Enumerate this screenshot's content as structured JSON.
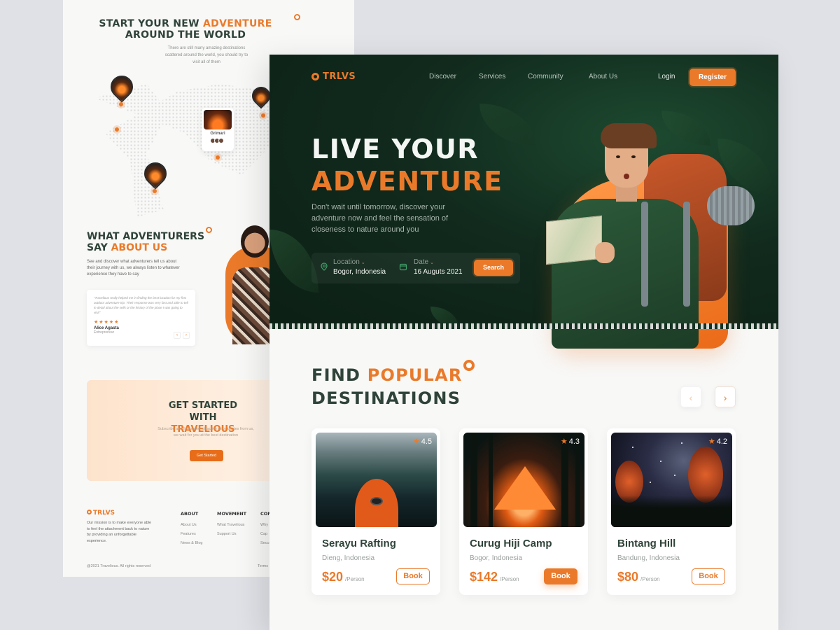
{
  "back": {
    "hero_title_1": "START YOUR NEW ",
    "hero_title_accent": "ADVENTURE",
    "hero_title_2": "AROUND THE WORLD",
    "hero_sub": "There are still many amazing destinations scattered around the world, you should try to visit all of them",
    "map_card_label": "Grimari",
    "say_title_1": "WHAT ADVENTURERS",
    "say_title_2": "SAY ",
    "say_title_accent": "ABOUT US",
    "say_sub": "See and discover what adventurers tell us about their journey with us, we always listen to whatever experience they have to say",
    "review_quote": "\"Travelious really helped me in finding the best location for my first outdoor adventure trip. Their response was very fast and able to tell in detail about the sells or the history of the place I was going to visit\"",
    "review_stars": "★★★★★",
    "review_name": "Alice Agasta",
    "review_role": "Entrepreneur",
    "review_prev": "‹",
    "review_next": "›",
    "started_title_1": "GET STARTED WITH",
    "started_title_accent": "TRAVELIOUS",
    "started_sub": "Subscribe and find super attractive price quotes from us, we wait for you at the best destination",
    "started_button": "Get Started",
    "footer_logo": "TRLVS",
    "footer_desc": "Our mission is to make everyone able to feel the attachment back to nature by providing an unforgettable experience.",
    "footer_about_heading": "ABOUT",
    "footer_about_items": [
      "About Us",
      "Features",
      "News & Blog"
    ],
    "footer_movement_heading": "MOVEMENT",
    "footer_movement_items": [
      "What Travelious",
      "Support Us"
    ],
    "footer_col3_heading": "CON",
    "footer_col3_items": [
      "Why",
      "Cap",
      "Secu"
    ],
    "footer_copy": "@2021 Travelious. All rights reserved",
    "footer_terms": "Terms"
  },
  "nav": {
    "logo": "TRLVS",
    "items": [
      "Discover",
      "Services",
      "Community",
      "About Us"
    ],
    "login": "Login",
    "register": "Register"
  },
  "hero": {
    "title_line1": "LIVE YOUR",
    "title_line2": "ADVENTURE",
    "description": "Don't wait until tomorrow, discover your adventure now and feel the sensation of closeness to nature around you",
    "location_label": "Location",
    "location_value": "Bogor, Indonesia",
    "date_label": "Date",
    "date_value": "16 Auguts 2021",
    "search_button": "Search",
    "chevron": "⌄"
  },
  "popular": {
    "title_1": "FIND ",
    "title_accent": "POPULAR",
    "title_2": "DESTINATIONS",
    "prev": "‹",
    "next": "›",
    "cards": [
      {
        "name": "Serayu Rafting",
        "location": "Dieng, Indonesia",
        "rating": "4.5",
        "price": "$20",
        "per": "/Person",
        "book": "Book"
      },
      {
        "name": "Curug Hiji Camp",
        "location": "Bogor, Indonesia",
        "rating": "4.3",
        "price": "$142",
        "per": "/Person",
        "book": "Book"
      },
      {
        "name": "Bintang Hill",
        "location": "Bandung, Indonesia",
        "rating": "4.2",
        "price": "$80",
        "per": "/Person",
        "book": "Book"
      }
    ]
  },
  "colors": {
    "accent": "#ea7a2a",
    "dark_green": "#112a1d",
    "heading": "#2f4339"
  },
  "icons": {
    "star": "★",
    "location": "location-pin-icon",
    "calendar": "calendar-icon"
  }
}
